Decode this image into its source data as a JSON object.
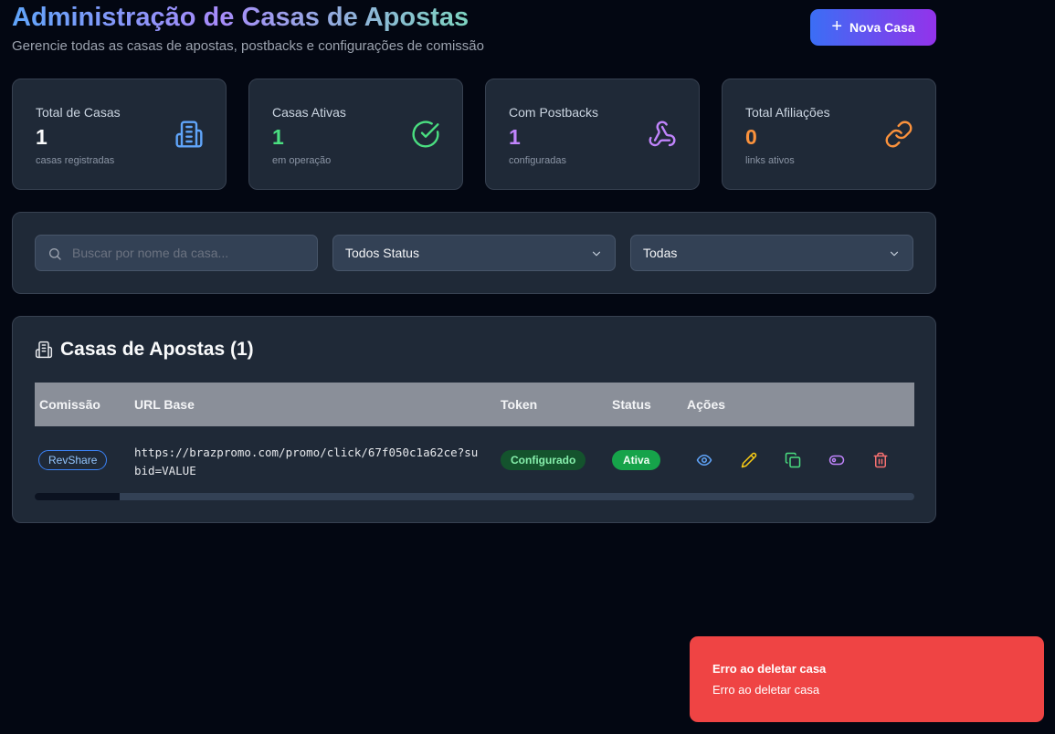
{
  "header": {
    "title": "Administração de Casas de Apostas",
    "subtitle": "Gerencie todas as casas de apostas, postbacks e configurações de comissão",
    "new_button": "Nova Casa"
  },
  "stats": [
    {
      "label": "Total de Casas",
      "value": "1",
      "desc": "casas registradas",
      "color": "#60a5fa",
      "icon": "building-icon"
    },
    {
      "label": "Casas Ativas",
      "value": "1",
      "desc": "em operação",
      "color": "#4ade80",
      "icon": "check-circle-icon"
    },
    {
      "label": "Com Postbacks",
      "value": "1",
      "desc": "configuradas",
      "color": "#c084fc",
      "icon": "webhook-icon"
    },
    {
      "label": "Total Afiliações",
      "value": "0",
      "desc": "links ativos",
      "color": "#fb923c",
      "icon": "link-icon"
    }
  ],
  "filters": {
    "search_placeholder": "Buscar por nome da casa...",
    "status_selected": "Todos Status",
    "type_selected": "Todas"
  },
  "table": {
    "title": "Casas de Apostas (1)",
    "columns": [
      "Comissão",
      "URL Base",
      "Token",
      "Status",
      "Ações"
    ],
    "rows": [
      {
        "commission": "RevShare",
        "url": "https://brazpromo.com/promo/click/67f050c1a62ce?subid=VALUE",
        "token": "Configurado",
        "status": "Ativa",
        "actions": [
          "view-icon",
          "edit-icon",
          "copy-icon",
          "toggle-icon",
          "delete-icon"
        ]
      }
    ]
  },
  "toast": {
    "title": "Erro ao deletar casa",
    "message": "Erro ao deletar casa"
  }
}
